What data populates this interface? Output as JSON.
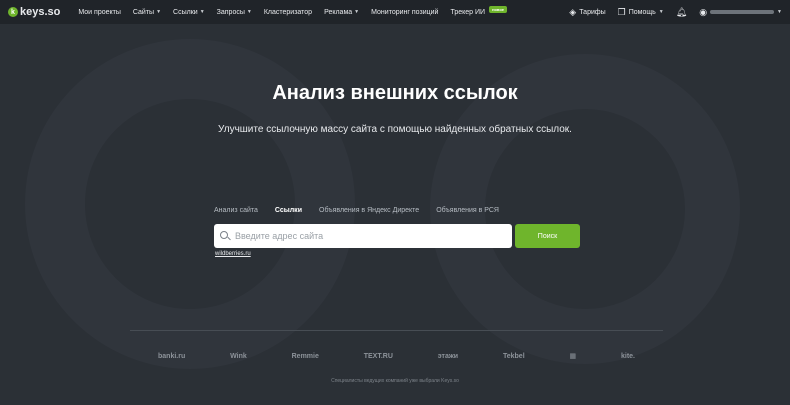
{
  "header": {
    "logo_text": "keys.so",
    "nav": [
      {
        "label": "Мои проекты",
        "dropdown": false
      },
      {
        "label": "Сайты",
        "dropdown": true
      },
      {
        "label": "Ссылки",
        "dropdown": true
      },
      {
        "label": "Запросы",
        "dropdown": true
      },
      {
        "label": "Кластеризатор",
        "dropdown": false
      },
      {
        "label": "Реклама",
        "dropdown": true
      },
      {
        "label": "Мониторинг позиций",
        "dropdown": false
      },
      {
        "label": "Трекер ИИ",
        "dropdown": false
      }
    ],
    "new_badge": "новое",
    "tariffs_label": "Тарифы",
    "help_label": "Помощь"
  },
  "hero": {
    "title": "Анализ внешних ссылок",
    "subtitle": "Улучшите ссылочную массу сайта с помощью найденных обратных ссылок."
  },
  "tabs": [
    {
      "label": "Анализ сайта",
      "active": false
    },
    {
      "label": "Ссылки",
      "active": true
    },
    {
      "label": "Объявления в Яндекс Директе",
      "active": false
    },
    {
      "label": "Объявления в РСЯ",
      "active": false
    }
  ],
  "search": {
    "placeholder": "Введите адрес сайта",
    "value": "",
    "button_label": "Поиск",
    "example": "wildberries.ru"
  },
  "partners": [
    "banki.ru",
    "Wink",
    "Remmie",
    "TEXT.RU",
    "этажи",
    "Tekbel",
    "▦",
    "kite."
  ],
  "footer_note": "Специалисты ведущих компаний уже выбрали Keys.so",
  "colors": {
    "accent": "#6fb52c",
    "background": "#2b3036",
    "nav_background": "#202429"
  }
}
